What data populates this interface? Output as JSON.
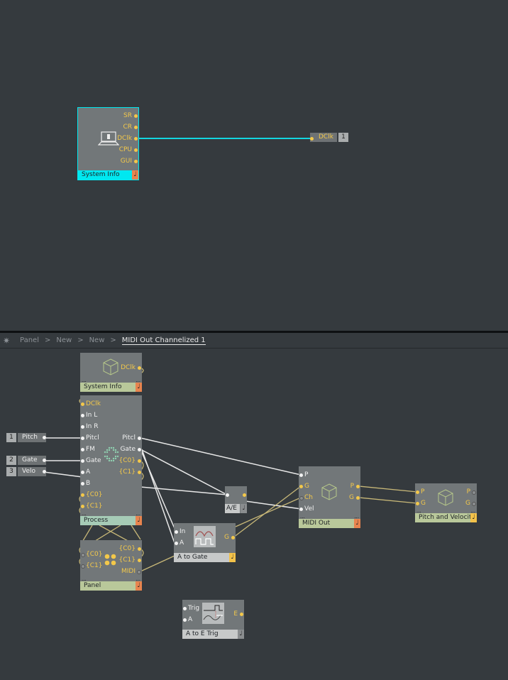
{
  "top_pane": {
    "system_info_module": {
      "title": "System Info",
      "outputs": [
        "SR",
        "CR",
        "DClk",
        "CPU",
        "GUI"
      ],
      "icon": "laptop-info-icon",
      "selected": true
    },
    "bus_out": {
      "label": "DClk",
      "number": "1"
    }
  },
  "breadcrumb": {
    "icon": "gear-icon",
    "items": [
      "Panel",
      "New",
      "New"
    ],
    "current": "MIDI Out Channelized 1"
  },
  "bottom_pane": {
    "system_info": {
      "title": "System Info",
      "output": "DClk",
      "icon": "cube-icon"
    },
    "bus_inputs": [
      {
        "number": "1",
        "label": "Pitch"
      },
      {
        "number": "2",
        "label": "Gate"
      },
      {
        "number": "3",
        "label": "Velo"
      }
    ],
    "process": {
      "title": "Process",
      "inputs": [
        "DClk",
        "In L",
        "In R",
        "Pitcl",
        "FM",
        "Gate",
        "A",
        "B",
        "{C0}",
        "{C1}"
      ],
      "outputs": [
        "Pitcl",
        "Gate",
        "{C0}",
        "{C1}"
      ],
      "icon": "grid-dots-icon"
    },
    "panel": {
      "title": "Panel",
      "inputs": [
        "{C0}",
        "{C1}"
      ],
      "outputs": [
        "{C0}",
        "{C1}",
        "MIDI"
      ],
      "icon": "knobs-icon"
    },
    "ae": {
      "title": "A/E"
    },
    "a_to_gate": {
      "title": "A to Gate",
      "inputs": [
        "In",
        "A"
      ],
      "output": "G",
      "icon": "waveform-gate-icon"
    },
    "midi_out": {
      "title": "MIDI Out",
      "inputs": [
        "P",
        "G",
        "Ch",
        "Vel"
      ],
      "outputs": [
        "P",
        "G"
      ],
      "icon": "cube-icon"
    },
    "pitch_velocity": {
      "title": "Pitch and Velocit",
      "inputs": [
        "P",
        "G"
      ],
      "outputs": [
        "P",
        "G"
      ],
      "icon": "cube-icon"
    },
    "a_to_e_trig": {
      "title": "A to E Trig",
      "inputs": [
        "Trig",
        "A"
      ],
      "output": "E",
      "icon": "trigger-envelope-icon"
    }
  },
  "colors": {
    "background": "#353a3e",
    "module": "#727779",
    "selected": "#00e8f0",
    "event_port": "#f3c84a",
    "audio_port": "#f2f2f2",
    "footer_green": "#b9c89a",
    "footer_teal": "#a6cbb6",
    "footer_grey": "#c7c9c9",
    "footer_tab_orange": "#e8844e",
    "footer_tab_yellow": "#f3c24a"
  }
}
